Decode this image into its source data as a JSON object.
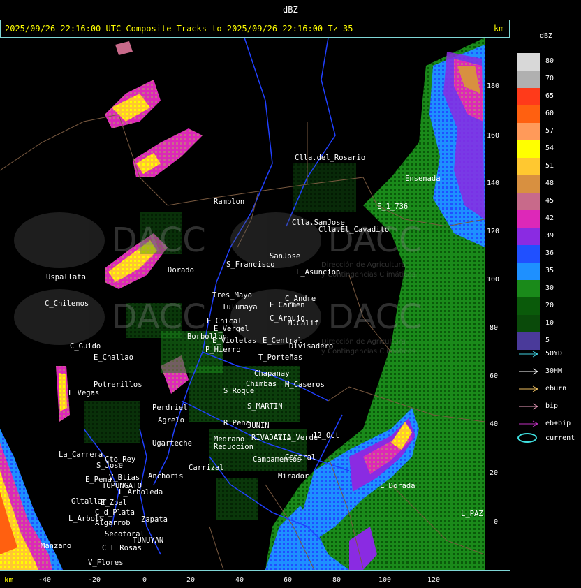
{
  "title": "dBZ",
  "header": {
    "text": "2025/09/26 22:16:00 UTC Composite Tracks to 2025/09/26 22:16:00 Tz 35",
    "km": "km"
  },
  "legend": {
    "title": "dBZ",
    "levels": [
      {
        "value": "80",
        "color": "#d8d8d8"
      },
      {
        "value": "70",
        "color": "#b0b0b0"
      },
      {
        "value": "65",
        "color": "#ff3a1a"
      },
      {
        "value": "60",
        "color": "#ff6010"
      },
      {
        "value": "57",
        "color": "#ff9a5a"
      },
      {
        "value": "54",
        "color": "#ffff00"
      },
      {
        "value": "51",
        "color": "#ffc830"
      },
      {
        "value": "48",
        "color": "#d89040"
      },
      {
        "value": "45",
        "color": "#c86a8a"
      },
      {
        "value": "42",
        "color": "#dd28b8"
      },
      {
        "value": "39",
        "color": "#8a2be2"
      },
      {
        "value": "36",
        "color": "#2050ff"
      },
      {
        "value": "35",
        "color": "#1e90ff"
      },
      {
        "value": "30",
        "color": "#1a8a1a"
      },
      {
        "value": "20",
        "color": "#0a5a0a"
      },
      {
        "value": "10",
        "color": "#0a4a0a"
      },
      {
        "value": "5",
        "color": "#4a3a9a"
      }
    ],
    "tracks": [
      {
        "label": "50YD",
        "color": "#40d0e0"
      },
      {
        "label": "30HM",
        "color": "#ffffff"
      },
      {
        "label": "eburn",
        "color": "#f0c060"
      },
      {
        "label": "bip",
        "color": "#f0a0c0"
      },
      {
        "label": "eb+bip",
        "color": "#c030c0"
      }
    ],
    "current_label": "current",
    "current_color": "#40e0e0"
  },
  "y_axis": {
    "ticks": [
      "180",
      "160",
      "140",
      "120",
      "100",
      "80",
      "60",
      "40",
      "20",
      "0"
    ]
  },
  "x_axis": {
    "km_label": "km",
    "ticks": [
      "-40",
      "-20",
      "0",
      "20",
      "40",
      "60",
      "80",
      "100",
      "120"
    ]
  },
  "watermark": {
    "text": "DACC",
    "sub1": "Dirección de Agricultura",
    "sub2": "y Contingencias Climáticas"
  },
  "places": [
    {
      "name": "Clla.del_Rosario"
    },
    {
      "name": "Ramblon"
    },
    {
      "name": "E_1_736"
    },
    {
      "name": "Clla.SanJose"
    },
    {
      "name": "Clla.El_Cavadito"
    },
    {
      "name": "Uspallata"
    },
    {
      "name": "Dorado"
    },
    {
      "name": "S_Francisco"
    },
    {
      "name": "SanJose"
    },
    {
      "name": "L_Asuncion"
    },
    {
      "name": "C_Chilenos"
    },
    {
      "name": "Tres_Mayo"
    },
    {
      "name": "Tulumaya"
    },
    {
      "name": "C_Andre"
    },
    {
      "name": "E_Carmen"
    },
    {
      "name": "E_Chical"
    },
    {
      "name": "C_Araujo"
    },
    {
      "name": "E_Vergel"
    },
    {
      "name": "M.Calif"
    },
    {
      "name": "Borbollon"
    },
    {
      "name": "E_Violetas"
    },
    {
      "name": "E_Central"
    },
    {
      "name": "Divisadero"
    },
    {
      "name": "C_Guido"
    },
    {
      "name": "P_Hierro"
    },
    {
      "name": "E_Challao"
    },
    {
      "name": "T_Porteñas"
    },
    {
      "name": "Chapanay"
    },
    {
      "name": "Potrerillos"
    },
    {
      "name": "Chimbas"
    },
    {
      "name": "M_Caseros"
    },
    {
      "name": "L_Vegas"
    },
    {
      "name": "S_Roque"
    },
    {
      "name": "S_MARTIN"
    },
    {
      "name": "Perdriel"
    },
    {
      "name": "Agrelo"
    },
    {
      "name": "R_Peña"
    },
    {
      "name": "JUNIN"
    },
    {
      "name": "Ugarteche"
    },
    {
      "name": "Medrano"
    },
    {
      "name": "RIVADAVIA"
    },
    {
      "name": "12_Oct"
    },
    {
      "name": "Reduccion"
    },
    {
      "name": "Alto_Verde"
    },
    {
      "name": "La_Carrera"
    },
    {
      "name": "Cto_Rey"
    },
    {
      "name": "Campamentos"
    },
    {
      "name": "Central"
    },
    {
      "name": "S_Jose"
    },
    {
      "name": "Anchoris"
    },
    {
      "name": "Carrizal"
    },
    {
      "name": "Mirador"
    },
    {
      "name": "E_Pena"
    },
    {
      "name": "V_Btias"
    },
    {
      "name": "TUPUNGATO"
    },
    {
      "name": "L_Arboleda"
    },
    {
      "name": "Gltallar"
    },
    {
      "name": "E_Zpal"
    },
    {
      "name": "C_d_Plata"
    },
    {
      "name": "L_Arbols"
    },
    {
      "name": "Zapata"
    },
    {
      "name": "Algarrob"
    },
    {
      "name": "Secotoral"
    },
    {
      "name": "Manzano"
    },
    {
      "name": "TUNUYAN"
    },
    {
      "name": "C_L_Rosas"
    },
    {
      "name": "V_Flores"
    },
    {
      "name": "L_Dorada"
    },
    {
      "name": "L_PAZ"
    },
    {
      "name": "Ensenada"
    }
  ]
}
